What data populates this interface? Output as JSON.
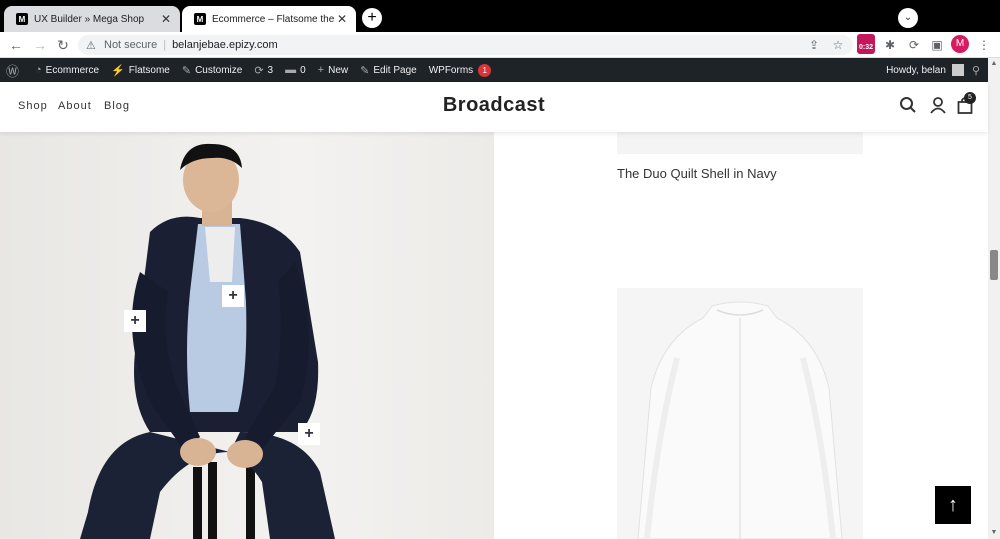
{
  "browser": {
    "tabs": [
      {
        "favicon": "M",
        "title": "UX Builder » Mega Shop"
      },
      {
        "favicon": "M",
        "title": "Ecommerce – Flatsome theme"
      }
    ],
    "address": {
      "security": "Not secure",
      "url": "belanjebae.epizy.com"
    },
    "extension_badge": "0:32",
    "profile_initial": "M"
  },
  "admin_bar": {
    "items": [
      "Ecommerce",
      "Flatsome",
      "Customize",
      "3",
      "0",
      "New",
      "Edit Page",
      "WPForms"
    ],
    "wpforms_count": "1",
    "greeting": "Howdy, belan"
  },
  "site": {
    "nav": [
      "Shop",
      "About",
      "Blog"
    ],
    "logo": "Broadcast",
    "cart_count": "5"
  },
  "content": {
    "product_name": "The Duo Quilt Shell in Navy",
    "hotspot_symbol": "+",
    "back_to_top_symbol": "↑"
  }
}
